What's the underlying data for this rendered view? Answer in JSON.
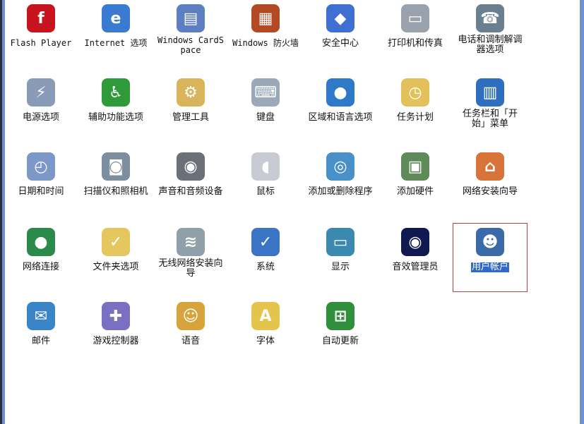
{
  "window": {
    "title": ""
  },
  "items": [
    {
      "label": "Flash Player",
      "icon": "flash-icon",
      "color": "#c8141e",
      "glyph": "f"
    },
    {
      "label": "Internet 选项",
      "icon": "internet-options-icon",
      "color": "#3a7ad0",
      "glyph": "e"
    },
    {
      "label": "Windows CardSpace",
      "icon": "cardspace-icon",
      "color": "#5d7ec0",
      "glyph": "▤"
    },
    {
      "label": "Windows 防火墙",
      "icon": "firewall-icon",
      "color": "#b24a26",
      "glyph": "▦"
    },
    {
      "label": "安全中心",
      "icon": "security-center-shield-icon",
      "color": "#3f6fd0",
      "glyph": "◆"
    },
    {
      "label": "打印机和传真",
      "icon": "printer-icon",
      "color": "#9aa3ad",
      "glyph": "▭"
    },
    {
      "label": "电话和调制解调器选项",
      "icon": "phone-modem-icon",
      "color": "#6a7f8f",
      "glyph": "☎"
    },
    {
      "label": "电源选项",
      "icon": "power-options-icon",
      "color": "#8a9bb8",
      "glyph": "⚡"
    },
    {
      "label": "辅助功能选项",
      "icon": "accessibility-icon",
      "color": "#2e9a3a",
      "glyph": "♿"
    },
    {
      "label": "管理工具",
      "icon": "admin-tools-icon",
      "color": "#d9b45a",
      "glyph": "⚙"
    },
    {
      "label": "键盘",
      "icon": "keyboard-icon",
      "color": "#9aa8b8",
      "glyph": "⌨"
    },
    {
      "label": "区域和语言选项",
      "icon": "globe-icon",
      "color": "#2f79c9",
      "glyph": "●"
    },
    {
      "label": "任务计划",
      "icon": "scheduled-tasks-icon",
      "color": "#e3c15a",
      "glyph": "◷"
    },
    {
      "label": "任务栏和「开始」菜单",
      "icon": "taskbar-icon",
      "color": "#2f6fbf",
      "glyph": "▥"
    },
    {
      "label": "日期和时间",
      "icon": "date-time-icon",
      "color": "#7b98c8",
      "glyph": "◴"
    },
    {
      "label": "扫描仪和照相机",
      "icon": "scanner-camera-icon",
      "color": "#7d8f9e",
      "glyph": "◙"
    },
    {
      "label": "声音和音频设备",
      "icon": "speaker-icon",
      "color": "#6b6f78",
      "glyph": "◉"
    },
    {
      "label": "鼠标",
      "icon": "mouse-icon",
      "color": "#c8ccd2",
      "glyph": "◖"
    },
    {
      "label": "添加或删除程序",
      "icon": "add-remove-programs-icon",
      "color": "#4a90c8",
      "glyph": "◎"
    },
    {
      "label": "添加硬件",
      "icon": "add-hardware-icon",
      "color": "#5f8a5a",
      "glyph": "▣"
    },
    {
      "label": "网络安装向导",
      "icon": "network-setup-house-icon",
      "color": "#d8743a",
      "glyph": "⌂"
    },
    {
      "label": "网络连接",
      "icon": "network-connections-icon",
      "color": "#2a8a4a",
      "glyph": "●"
    },
    {
      "label": "文件夹选项",
      "icon": "folder-options-icon",
      "color": "#e6c65e",
      "glyph": "✓"
    },
    {
      "label": "无线网络安装向导",
      "icon": "wireless-setup-icon",
      "color": "#8fa0a8",
      "glyph": "≋"
    },
    {
      "label": "系统",
      "icon": "system-icon",
      "color": "#3a74c4",
      "glyph": "✓"
    },
    {
      "label": "显示",
      "icon": "display-icon",
      "color": "#3a8ab0",
      "glyph": "▭"
    },
    {
      "label": "音效管理员",
      "icon": "sound-manager-icon",
      "color": "#101a50",
      "glyph": "◉"
    },
    {
      "label": "用户帐户",
      "icon": "user-accounts-icon",
      "color": "#3b6aa8",
      "glyph": "☻",
      "selected": true
    },
    {
      "label": "邮件",
      "icon": "mail-icon",
      "color": "#3a84c8",
      "glyph": "✉"
    },
    {
      "label": "游戏控制器",
      "icon": "game-controller-icon",
      "color": "#7a6fc0",
      "glyph": "✚"
    },
    {
      "label": "语音",
      "icon": "speech-icon",
      "color": "#d7a33a",
      "glyph": "☺"
    },
    {
      "label": "字体",
      "icon": "fonts-folder-icon",
      "color": "#e5c44e",
      "glyph": "A"
    },
    {
      "label": "自动更新",
      "icon": "automatic-updates-icon",
      "color": "#2f8f3a",
      "glyph": "⊞"
    }
  ]
}
